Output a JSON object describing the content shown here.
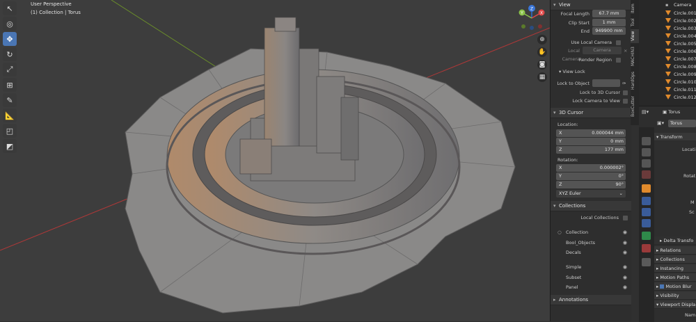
{
  "viewport": {
    "perspective": "User Perspective",
    "collection_info": "(1) Collection | Torus",
    "nav_icons": [
      "zoom-icon",
      "hand-icon",
      "camera-icon",
      "grid-icon"
    ]
  },
  "gizmo": {
    "z": "Z",
    "y": "Y",
    "x": "X"
  },
  "view": {
    "header": "View",
    "focal_length_label": "Focal Length",
    "focal_length": "67.7 mm",
    "clip_start_label": "Clip Start",
    "clip_start": "1 mm",
    "end_label": "End",
    "end": "949900 mm",
    "use_local_camera": "Use Local Camera",
    "local_camera_label": "Local Camera",
    "local_camera_value": "Camera",
    "render_region": "Render Region",
    "view_lock_header": "View Lock",
    "lock_to_object": "Lock to Object",
    "lock_to_3d_cursor": "Lock to 3D Cursor",
    "lock_camera_to_view": "Lock Camera to View"
  },
  "cursor": {
    "header": "3D Cursor",
    "location_label": "Location:",
    "loc_x_label": "X",
    "loc_x": "0.000044 mm",
    "loc_y_label": "Y",
    "loc_y": "0 mm",
    "loc_z_label": "Z",
    "loc_z": "177 mm",
    "rotation_label": "Rotation:",
    "rot_x_label": "X",
    "rot_x": "0.000002°",
    "rot_y_label": "Y",
    "rot_y": "0°",
    "rot_z_label": "Z",
    "rot_z": "90°",
    "rotation_mode": "XYZ Euler"
  },
  "collections": {
    "header": "Collections",
    "local_collections": "Local Collections",
    "items": [
      "Collection",
      "Bool_Objects",
      "Decals",
      "Simple",
      "Subset",
      "Panel"
    ]
  },
  "annotations": {
    "header": "Annotations"
  },
  "sidebar_tabs": [
    "Item",
    "Tool",
    "View",
    "MACHIN3",
    "HardOps",
    "BoxCutter"
  ],
  "outliner": {
    "items": [
      "Camera",
      "Circle.001",
      "Circle.002",
      "Circle.003",
      "Circle.004",
      "Circle.005",
      "Circle.006",
      "Circle.007",
      "Circle.008",
      "Circle.009",
      "Circle.010",
      "Circle.011",
      "Circle.012"
    ]
  },
  "properties": {
    "object_name": "Torus",
    "object_field": "Torus",
    "transform": "Transform",
    "location": "Locati",
    "rotation": "Rotat",
    "mode": "M",
    "scale": "Sc",
    "delta_transform": "Delta Transfo",
    "relations": "Relations",
    "collections": "Collections",
    "instancing": "Instancing",
    "motion_paths": "Motion Paths",
    "motion_blur": "Motion Blur",
    "visibility": "Visibility",
    "viewport_display": "Viewport Displa",
    "name": "Nam"
  },
  "colors": {
    "accent": "#4a76b4",
    "object_orange": "#e08a2c",
    "axis_red": "#b03838",
    "axis_green": "#6b8f2a"
  }
}
